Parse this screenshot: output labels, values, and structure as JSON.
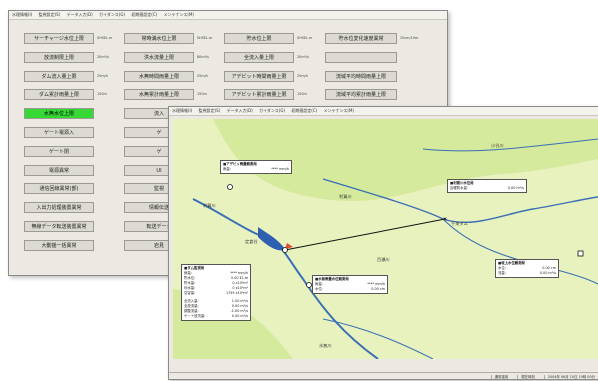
{
  "back_window": {
    "menu": [
      "水理情報(I)",
      "監視設定(S)",
      "データ入力(D)",
      "ガイダンス(G)",
      "初期値設定(C)",
      "メンテナンス(M)"
    ],
    "col1": [
      "サーチャージ水位上限",
      "放流制限上限",
      "ダム流入量上限",
      "ダム累計雨量上限",
      "水無水位上限",
      "ゲート電源入",
      "ゲート閉",
      "電源異常",
      "通信回線異常(部)",
      "入出力処理装置異常",
      "無線データ転送装置異常",
      "大動揺一括異常"
    ],
    "col1_vals": [
      "SHSEL.m",
      "20m³/s",
      "25m/h",
      "150m",
      "",
      "",
      "",
      "",
      "",
      "",
      "",
      ""
    ],
    "col2": [
      "常時満水位上限",
      "洪水流量上限",
      "水無時間雨量上限",
      "水無累計雨量上限",
      "流入",
      "ゲ",
      "ゲ",
      "UI",
      "監視",
      "情報伝送",
      "転送データ",
      "岩見"
    ],
    "col2_vals": [
      "SHSEL.m",
      "80m³/s",
      "25m/h",
      "150m"
    ],
    "col3": [
      "貯水位上限",
      "全流入量上限",
      "アデビット時間雨量上限",
      "アデビット累計雨量上限"
    ],
    "col3_vals": [
      "SHSEL.m",
      "20m³/s",
      "25m/h",
      "150m"
    ],
    "col4": [
      "貯水位変化速度異常",
      "",
      "流域平均時間雨量上限",
      "流域平均累計雨量上限"
    ],
    "col4_vals": [
      "25cm/10m",
      "",
      "",
      ""
    ]
  },
  "front_window": {
    "menu": [
      "水理情報(I)",
      "監視設定(S)",
      "データ入力(D)",
      "ガイダンス(G)",
      "初期値設定(C)",
      "メンテナンス(M)"
    ],
    "status": [
      "通常運用",
      "現在時刻",
      "2004年 06月 10日 19時 00分"
    ],
    "boxes": {
      "rain": {
        "title": "■アデビッ雨量観測局",
        "rows": [
          [
            "雨量:",
            "**** mm/h"
          ]
        ]
      },
      "upper": {
        "title": "■利賀川水位局",
        "rows": [
          [
            "反曜防水量:",
            "0.00 m³/s"
          ]
        ]
      },
      "dam": {
        "title": "■ダム監視局",
        "rows": [
          [
            "雨量:",
            "**** mm/h"
          ],
          [
            "貯水位:",
            "0.00 EL.m"
          ],
          [
            "貯水量:",
            "0 x10³m³"
          ],
          [
            "利水量:",
            "0 x10³m³"
          ],
          [
            "空容量:",
            "1759 x10³m³"
          ],
          [
            "全流入量:",
            "1.00 m³/s"
          ],
          [
            "全放流量:",
            "0.00 m³/s"
          ],
          [
            "調整流量:",
            "-1.00 m³/s"
          ],
          [
            "ゲート放流量:",
            "0.00 m³/s"
          ]
        ]
      },
      "gauge": {
        "title": "■水無雨量水位観測局",
        "rows": [
          [
            "雨量:",
            "**** mm/h"
          ],
          [
            "水位:",
            "0.00 cm"
          ]
        ]
      },
      "lower": {
        "title": "■坂上水位観測局",
        "rows": [
          [
            "水位:",
            "0.00 cm"
          ],
          [
            "流量:",
            "0.00 m³/s"
          ]
        ]
      }
    },
    "labels": {
      "river1": "小谷川",
      "river2": "利賀川",
      "river3": "利賀川",
      "dam_name": "千束ダム",
      "station": "定倉谷",
      "river4": "百瀬川",
      "river5": "水無川"
    }
  }
}
